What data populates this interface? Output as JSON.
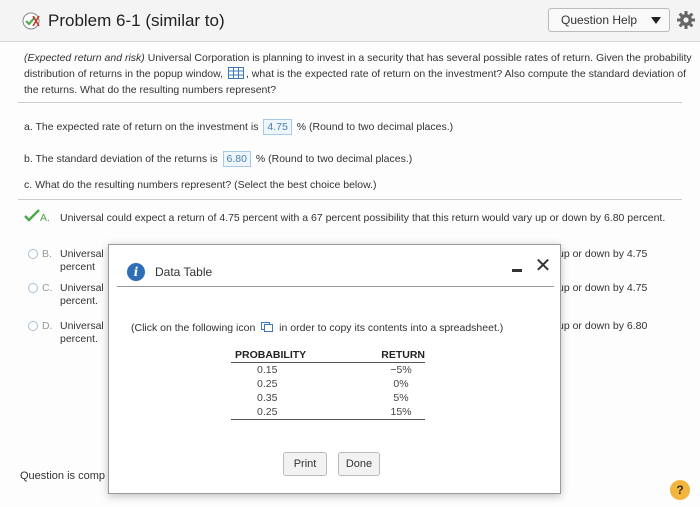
{
  "header": {
    "title": "Problem 6-1 (similar to)",
    "help_label": "Question Help"
  },
  "question": {
    "intro_italic": "(Expected return and risk)",
    "intro_rest": "Universal Corporation is planning to invest in a security that has several possible rates of return. Given the probability distribution of returns in the popup window,",
    "intro_end": ", what is the expected rate of return on the investment? Also compute the standard deviation of the returns. What do the resulting numbers represent?",
    "a_prefix": "a. The expected rate of return on the investment is",
    "a_value": "4.75",
    "a_suffix": "%  (Round to two decimal places.)",
    "b_prefix": "b. The standard deviation of the returns is",
    "b_value": "6.80",
    "b_suffix": "%  (Round to two decimal places.)",
    "c_text": "c. What do the resulting numbers represent?  (Select the best choice below.)"
  },
  "options": [
    {
      "letter": "A.",
      "text": "Universal could expect a return of 4.75 percent with a 67 percent possibility that this return would vary up or down by 6.80 percent.",
      "right": ""
    },
    {
      "letter": "B.",
      "text": "Universal",
      "text2": "percent",
      "right": "up or down by 4.75"
    },
    {
      "letter": "C.",
      "text": "Universal",
      "text2": "percent.",
      "right": "up or down by 4.75"
    },
    {
      "letter": "D.",
      "text": "Universal",
      "text2": "percent.",
      "right": "up or down by 6.80"
    }
  ],
  "status": "Question is comp",
  "modal": {
    "title": "Data Table",
    "note_before": "(Click on the following icon",
    "note_after": "in order to copy its contents into a spreadsheet.)",
    "col_probability": "PROBABILITY",
    "col_return": "RETURN",
    "rows": [
      {
        "probability": "0.15",
        "return": "−5%"
      },
      {
        "probability": "0.25",
        "return": "0%"
      },
      {
        "probability": "0.35",
        "return": "5%"
      },
      {
        "probability": "0.25",
        "return": "15%"
      }
    ],
    "print_label": "Print",
    "done_label": "Done"
  },
  "help_glyph": "?",
  "colors": {
    "accent": "#2f6db5",
    "answer_text": "#4b7fb3",
    "help_badge": "#f2b53d",
    "check_green": "#4aa84a"
  }
}
